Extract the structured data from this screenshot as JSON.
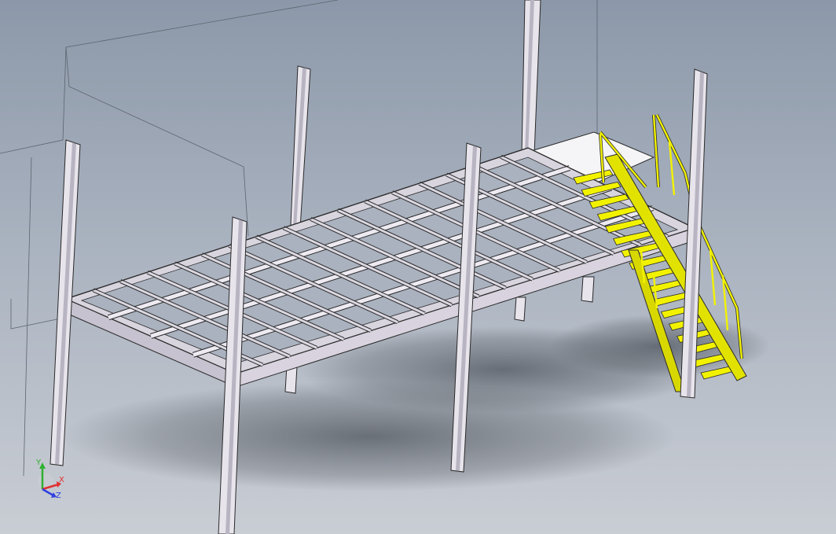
{
  "viewport": {
    "colors": {
      "background_top": "#8c98a9",
      "background_bottom": "#c9cdd4",
      "steel": "#e6e2ea",
      "steel_shade": "#b8b3c0",
      "edge": "#3a3a3a",
      "stair_yellow": "#f2f200",
      "landing_top": "#f4f4f6",
      "shadow": "#5a5f66"
    }
  },
  "triad": {
    "x_label": "X",
    "y_label": "Y",
    "z_label": "Z",
    "x_color": "#e03030",
    "y_color": "#30b030",
    "z_color": "#3040e0"
  }
}
